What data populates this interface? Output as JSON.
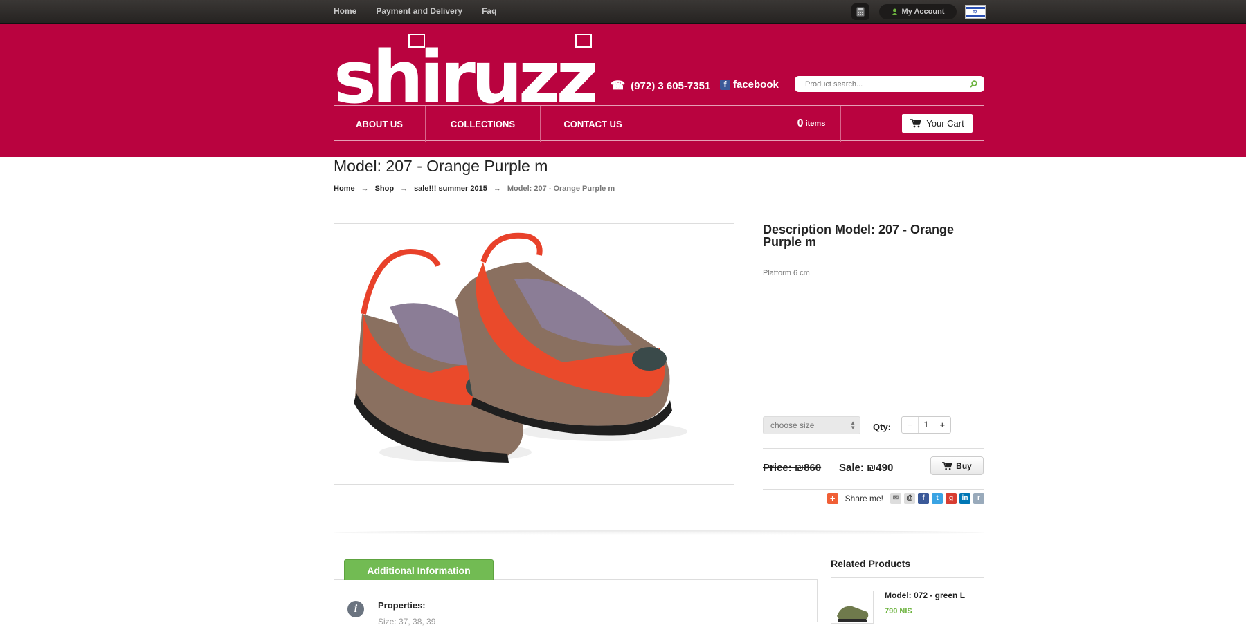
{
  "topbar": {
    "nav": [
      "Home",
      "Payment and Delivery",
      "Faq"
    ],
    "account_label": "My Account",
    "flag": "israel-flag"
  },
  "header": {
    "logo_text": "shiruzzi",
    "phone": "(972) 3 605-7351",
    "facebook": "facebook",
    "search_placeholder": "Product search...",
    "nav": [
      "ABOUT US",
      "COLLECTIONS",
      "CONTACT US"
    ],
    "cart_count": "0",
    "cart_items_label": "items",
    "cart_button": "Your Cart"
  },
  "product": {
    "title": "Model: 207 - Orange Purple m",
    "breadcrumb": [
      "Home",
      "Shop",
      "sale!!! summer 2015",
      "Model: 207 - Orange Purple m"
    ],
    "description_title": "Description Model: 207 - Orange Purple m",
    "description": "Platform 6 cm",
    "size_select": "choose size",
    "qty_label": "Qty:",
    "qty_value": "1",
    "price_label": "Price: ₪860",
    "sale_label": "Sale: ₪490",
    "buy_label": "Buy",
    "share_label": "Share me!"
  },
  "tabs": {
    "additional_info": "Additional Information",
    "properties_label": "Properties:",
    "sizes": "Size: 37, 38, 39"
  },
  "related": {
    "title": "Related Products",
    "items": [
      {
        "name": "Model: 072 - green L",
        "price": "790 NIS"
      }
    ]
  },
  "colors": {
    "brand": "#b9033f",
    "topbar": "#2c2927",
    "tab_green": "#72bb53",
    "price_green": "#6db33f"
  }
}
